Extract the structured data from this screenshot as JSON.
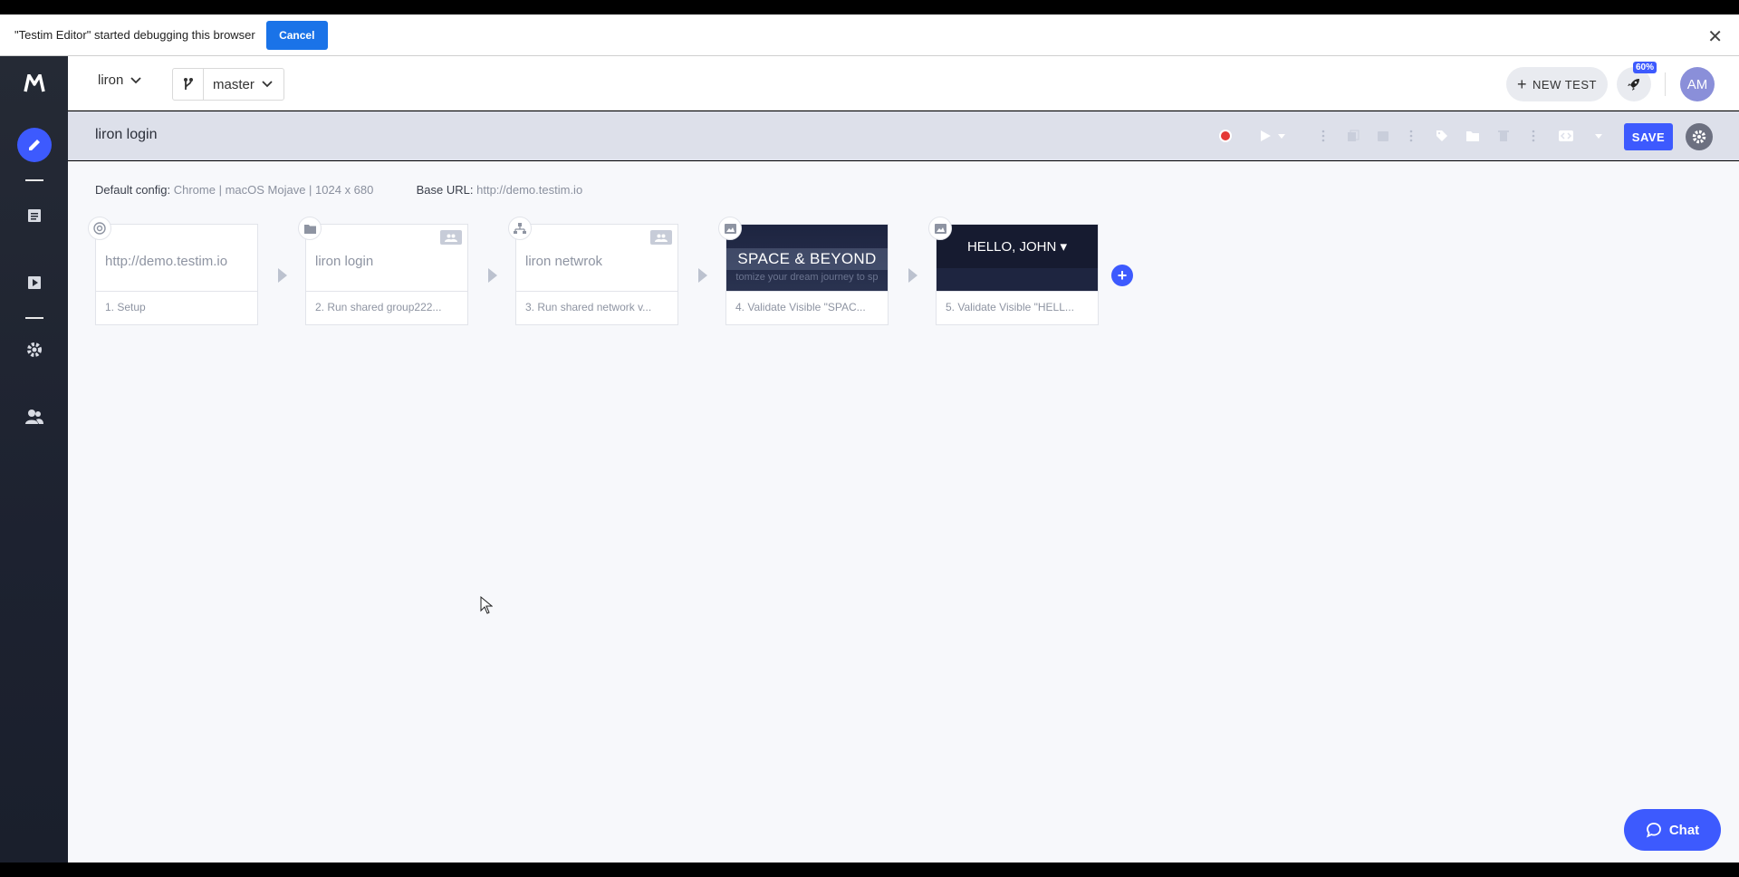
{
  "debug_bar": {
    "message": "\"Testim Editor\" started debugging this browser",
    "cancel_label": "Cancel",
    "close_glyph": "✕"
  },
  "sidebar": {
    "logo": "M",
    "items": [
      {
        "icon": "pencil-icon",
        "active": true
      },
      {
        "icon": "list-icon"
      },
      {
        "icon": "play-icon"
      },
      {
        "icon": "gear-icon"
      },
      {
        "icon": "users-icon"
      }
    ]
  },
  "header": {
    "project": "liron",
    "branch": "master",
    "new_test_label": "NEW TEST",
    "progress_badge": "60%",
    "avatar_initials": "AM"
  },
  "test": {
    "title": "liron login",
    "save_label": "SAVE"
  },
  "config": {
    "default_label": "Default config:",
    "default_value": "Chrome | macOS Mojave | 1024 x 680",
    "base_url_label": "Base URL:",
    "base_url_value": "http://demo.testim.io"
  },
  "steps": [
    {
      "name": "http://demo.testim.io",
      "caption": "1. Setup",
      "badge": "chrome-icon"
    },
    {
      "name": "liron login",
      "caption": "2. Run shared group222...",
      "badge": "folder-icon",
      "shared": true
    },
    {
      "name": "liron netwrok",
      "caption": "3. Run shared network v...",
      "badge": "network-icon",
      "shared": true
    },
    {
      "thumb_title": "SPACE & BEYOND",
      "thumb_sub": "tomize your dream journey to sp",
      "caption": "4. Validate Visible \"SPAC...",
      "badge": "image-icon"
    },
    {
      "thumb_title": "HELLO, JOHN ▾",
      "caption": "5. Validate Visible \"HELL...",
      "badge": "image-icon"
    }
  ],
  "add_step_glyph": "+",
  "chat_label": "Chat",
  "colors": {
    "accent": "#3d5afe",
    "sidebar": "#1d2230",
    "record": "#e53935"
  }
}
